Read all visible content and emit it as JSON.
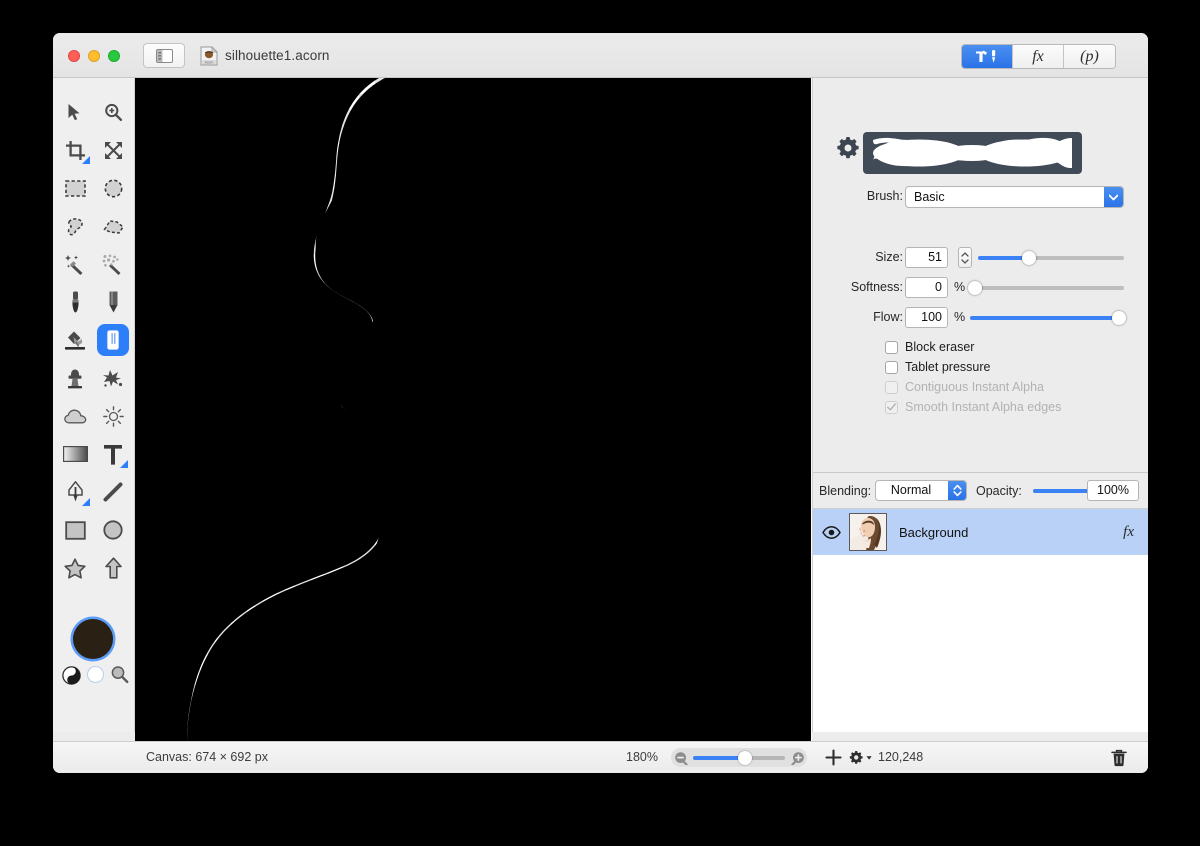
{
  "window": {
    "document_title": "silhouette1.acorn",
    "traffic_lights": [
      "close",
      "minimize",
      "maximize"
    ],
    "sidebar_toggle_icon": "sidebar-toggle-icon",
    "document_icon": "acorn-document-icon"
  },
  "mode_switch": {
    "segments": [
      {
        "name": "tools",
        "icon": "hammer-brush-icon",
        "label": "",
        "active": true
      },
      {
        "name": "filters",
        "icon": "fx-icon",
        "label": "fx",
        "active": false
      },
      {
        "name": "palettes",
        "icon": "palette-p-icon",
        "label": "(p)",
        "active": false
      }
    ]
  },
  "tools": [
    {
      "name": "move-tool",
      "icon": "arrow-cursor-icon",
      "selected": false
    },
    {
      "name": "zoom-tool",
      "icon": "magnifier-plus-icon",
      "selected": false
    },
    {
      "name": "crop-tool",
      "icon": "crop-icon",
      "selected": false
    },
    {
      "name": "transform-tool",
      "icon": "move-arrows-icon",
      "selected": false
    },
    {
      "name": "rectangular-selection-tool",
      "icon": "marquee-rect-icon",
      "selected": false
    },
    {
      "name": "elliptical-selection-tool",
      "icon": "marquee-ellipse-icon",
      "selected": false
    },
    {
      "name": "lasso-tool",
      "icon": "lasso-icon",
      "selected": false
    },
    {
      "name": "polygonal-lasso-tool",
      "icon": "polygon-lasso-icon",
      "selected": false
    },
    {
      "name": "magic-wand-tool",
      "icon": "magic-wand-icon",
      "selected": false
    },
    {
      "name": "instant-alpha-tool",
      "icon": "instant-alpha-wand-icon",
      "selected": false
    },
    {
      "name": "paint-brush-tool",
      "icon": "paintbrush-icon",
      "selected": false
    },
    {
      "name": "pencil-tool",
      "icon": "pencil-icon",
      "selected": false
    },
    {
      "name": "paint-bucket-tool",
      "icon": "paint-bucket-icon",
      "selected": false
    },
    {
      "name": "eraser-tool",
      "icon": "eraser-icon",
      "selected": true
    },
    {
      "name": "clone-stamp-tool",
      "icon": "clone-stamp-icon",
      "selected": false
    },
    {
      "name": "smudge-tool",
      "icon": "smudge-splatter-icon",
      "selected": false
    },
    {
      "name": "blur-tool",
      "icon": "cloud-blur-icon",
      "selected": false
    },
    {
      "name": "dodge-burn-tool",
      "icon": "sun-dodge-icon",
      "selected": false
    },
    {
      "name": "gradient-tool",
      "icon": "gradient-icon",
      "selected": false
    },
    {
      "name": "text-tool",
      "icon": "text-t-icon",
      "selected": false
    },
    {
      "name": "bezier-pen-tool",
      "icon": "bezier-pen-icon",
      "selected": false
    },
    {
      "name": "line-tool",
      "icon": "line-icon",
      "selected": false
    },
    {
      "name": "rectangle-shape-tool",
      "icon": "rectangle-icon",
      "selected": false
    },
    {
      "name": "ellipse-shape-tool",
      "icon": "ellipse-icon",
      "selected": false
    },
    {
      "name": "star-shape-tool",
      "icon": "star-icon",
      "selected": false
    },
    {
      "name": "arrow-shape-tool",
      "icon": "arrow-shape-icon",
      "selected": false
    }
  ],
  "color_well": {
    "foreground_color": "#2a2014",
    "focus_ring_color": "#5a9cf8",
    "swap_icon": "black-white-swap-icon",
    "empty_icon": "no-color-circle-icon",
    "picker_icon": "color-picker-magnifier-icon"
  },
  "inspector": {
    "gear_icon": "brush-settings-gear-icon",
    "brush_preview_bg": "#414a57",
    "brush": {
      "label": "Brush:",
      "value": "Basic"
    },
    "size": {
      "label": "Size:",
      "value": "51",
      "slider_percent": 35
    },
    "softness": {
      "label": "Softness:",
      "value": "0",
      "unit": "%",
      "slider_percent": 0
    },
    "flow": {
      "label": "Flow:",
      "value": "100",
      "unit": "%",
      "slider_percent": 100
    },
    "checkboxes": [
      {
        "label": "Block eraser",
        "checked": false,
        "enabled": true
      },
      {
        "label": "Tablet pressure",
        "checked": false,
        "enabled": true
      },
      {
        "label": "Contiguous Instant Alpha",
        "checked": false,
        "enabled": false
      },
      {
        "label": "Smooth Instant Alpha edges",
        "checked": true,
        "enabled": false
      }
    ]
  },
  "layers": {
    "blending_label": "Blending:",
    "blending_value": "Normal",
    "opacity_label": "Opacity:",
    "opacity_value": "100%",
    "opacity_percent": 100,
    "items": [
      {
        "name": "Background",
        "visible": true,
        "has_effects": true,
        "selected": true,
        "thumbnail": "portrait-photo-thumbnail"
      }
    ]
  },
  "statusbar": {
    "canvas_size": "Canvas: 674 × 692 px",
    "zoom_level": "180%",
    "zoom_out_icon": "zoom-out-icon",
    "zoom_in_icon": "zoom-in-icon",
    "zoom_slider_percent": 57,
    "add_layer_icon": "plus-icon",
    "layer_actions_icon": "gear-dropdown-icon",
    "coordinates": "120,248",
    "delete_icon": "trash-icon"
  },
  "canvas": {
    "content_description": "black-head-silhouette-on-transparent-background",
    "silhouette_color": "#000000",
    "checker_light": "#ffffff",
    "checker_dark": "#e3e3e3"
  },
  "colors": {
    "accent_blue": "#2d7ff9",
    "selection_blue": "#b9d1f7",
    "window_bg": "#ececec"
  }
}
